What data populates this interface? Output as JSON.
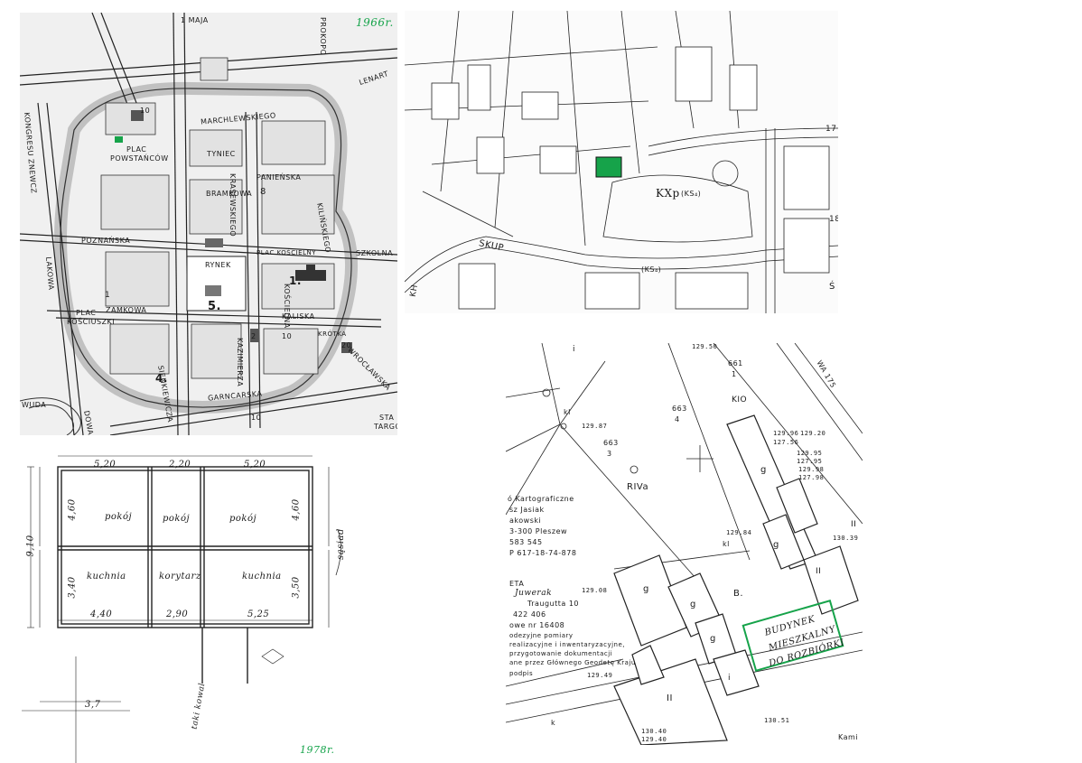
{
  "town_map": {
    "year_stamp": "1966r.",
    "streets": {
      "maja": "1 MAJA",
      "prokop": "PROKOPO",
      "lenart": "LENART",
      "szeweska": "SZEWSKA",
      "kongresu": "KONGRESU ZNEWCZ",
      "marchlewskiego": "MARCHLEWSKIEGO",
      "tyniec": "TYNIEC",
      "panienska": "PANIEŃSKA",
      "bramkowa": "BRAMKOWA",
      "krasewskiego": "KRASEWSKIEGO",
      "poznanska": "POZNAŃSKA",
      "szkolna": "SZKOLNA",
      "rynek": "RYNEK",
      "plac_kosciel": "PLAC KOŚCIELNY",
      "kosciel": "KOŚCIELNA",
      "kaliska": "KALISKA",
      "zamkowa": "ZAMKOWA",
      "plac_kosciuszki_1": "PLAC",
      "plac_kosciuszki_2": "KOŚCIUSZKI",
      "kazimierza": "KAZIMIERZA",
      "garncarska": "GARNCARSKA",
      "targowa_1": "STA",
      "targowa_2": "TARGO",
      "wroclawska": "WROCŁAWSKA",
      "sienkiewicza": "SIENKIEWICZA",
      "pl_powstancow_1": "PLAC",
      "pl_powstancow_2": "POWSTAŃCÓW",
      "krotka": "KRÓTKA",
      "kilinskiego": "KILIŃSKIEGO",
      "wuda": "WUDA",
      "dowa": "DOWA",
      "lakowa": "LAKOWA"
    },
    "numbers": [
      "1.",
      "4.",
      "5.",
      "8",
      "10",
      "1",
      "2",
      "10",
      "10",
      "20"
    ]
  },
  "cadastral_top": {
    "labels": [
      "KXp",
      "(KS₄)",
      "SKUP",
      "(KS₄)",
      "17",
      "18",
      "KH",
      "Ś"
    ]
  },
  "floor_plan": {
    "year_stamp": "1978r.",
    "dims": [
      "5,20",
      "2,20",
      "5,20",
      "4,60",
      "4,60",
      "9,10",
      "3,40",
      "3,50",
      "4,40",
      "2,90",
      "5,25",
      "3,7"
    ],
    "rooms": [
      "pokój",
      "pokój",
      "pokój",
      "kuchnia",
      "korytarz",
      "kuchnia"
    ],
    "side_note": "sąsiad",
    "bottom_note": "taki kowal"
  },
  "cadastral_bottom": {
    "parcels": [
      "661",
      "1",
      "663",
      "4",
      "663",
      "3"
    ],
    "codes": [
      "KIO",
      "RIVa",
      "B.",
      "II",
      "II",
      "g",
      "g",
      "g",
      "g",
      "g",
      "II",
      "i",
      "i",
      "kl",
      "kl",
      "k"
    ],
    "heights": [
      "129.87",
      "129.84",
      "129.96",
      "127.56",
      "129.20",
      "129.95",
      "127.95",
      "129.98",
      "127.98",
      "130.39",
      "129.08",
      "129.49",
      "130.40",
      "129.40",
      "130.51",
      "129.50"
    ],
    "stamp_lines": [
      "ó Kartograficzne",
      "sz Jasiak",
      "akowski",
      "3-300 Pleszew",
      "583 545",
      "P 617-18-74-878"
    ],
    "stamp2_lines": [
      "ETA",
      "Juwerak",
      "Traugutta 10",
      "422 406",
      "owe nr 16408"
    ],
    "notes": [
      "odezyjne pomiary",
      "realizacyjne i inwentaryzacyjne,",
      "przygotowanie dokumentacji",
      "ane przez Głównego Geodetę Kraju",
      "podpis"
    ],
    "green_box": [
      "BUDYNEK",
      "MIESZKALNY",
      "DO ROZBIÓRKI"
    ],
    "road": "WA 175",
    "corner_code": "Kami"
  }
}
